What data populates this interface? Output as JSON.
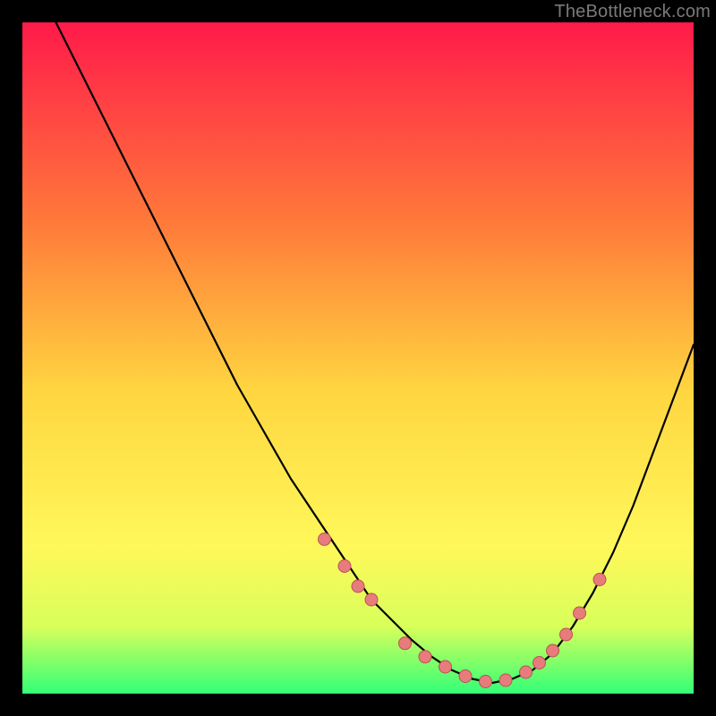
{
  "attribution": "TheBottleneck.com",
  "palette": {
    "black": "#000000",
    "curve": "#000000",
    "dot_fill": "#e87c7c",
    "dot_stroke": "#b75252",
    "gradient_top": "#ff1a4a",
    "gradient_mid_upper": "#ff7a3a",
    "gradient_mid": "#ffd640",
    "gradient_mid_lower": "#fff85a",
    "gradient_low": "#d8ff5a",
    "gradient_bottom": "#33ff77"
  },
  "chart_data": {
    "type": "line",
    "title": "",
    "xlabel": "",
    "ylabel": "",
    "xlim": [
      0,
      100
    ],
    "ylim": [
      0,
      100
    ],
    "series": [
      {
        "name": "bottleneck-curve",
        "x": [
          5,
          8,
          12,
          16,
          20,
          24,
          28,
          32,
          36,
          40,
          44,
          48,
          52,
          55,
          58,
          61,
          64,
          67,
          70,
          73,
          76,
          79,
          82,
          85,
          88,
          91,
          94,
          97,
          100
        ],
        "y": [
          100,
          94,
          86,
          78,
          70,
          62,
          54,
          46,
          39,
          32,
          26,
          20,
          14,
          11,
          8,
          5.5,
          3.5,
          2.2,
          1.6,
          2.2,
          3.5,
          6,
          10,
          15,
          21,
          28,
          36,
          44,
          52
        ]
      }
    ],
    "markers": {
      "name": "highlighted-points",
      "x": [
        45,
        48,
        50,
        52,
        57,
        60,
        63,
        66,
        69,
        72,
        75,
        77,
        79,
        81,
        83,
        86
      ],
      "y": [
        23,
        19,
        16,
        14,
        7.5,
        5.5,
        4,
        2.6,
        1.8,
        2,
        3.2,
        4.6,
        6.4,
        8.8,
        12,
        17
      ]
    }
  }
}
